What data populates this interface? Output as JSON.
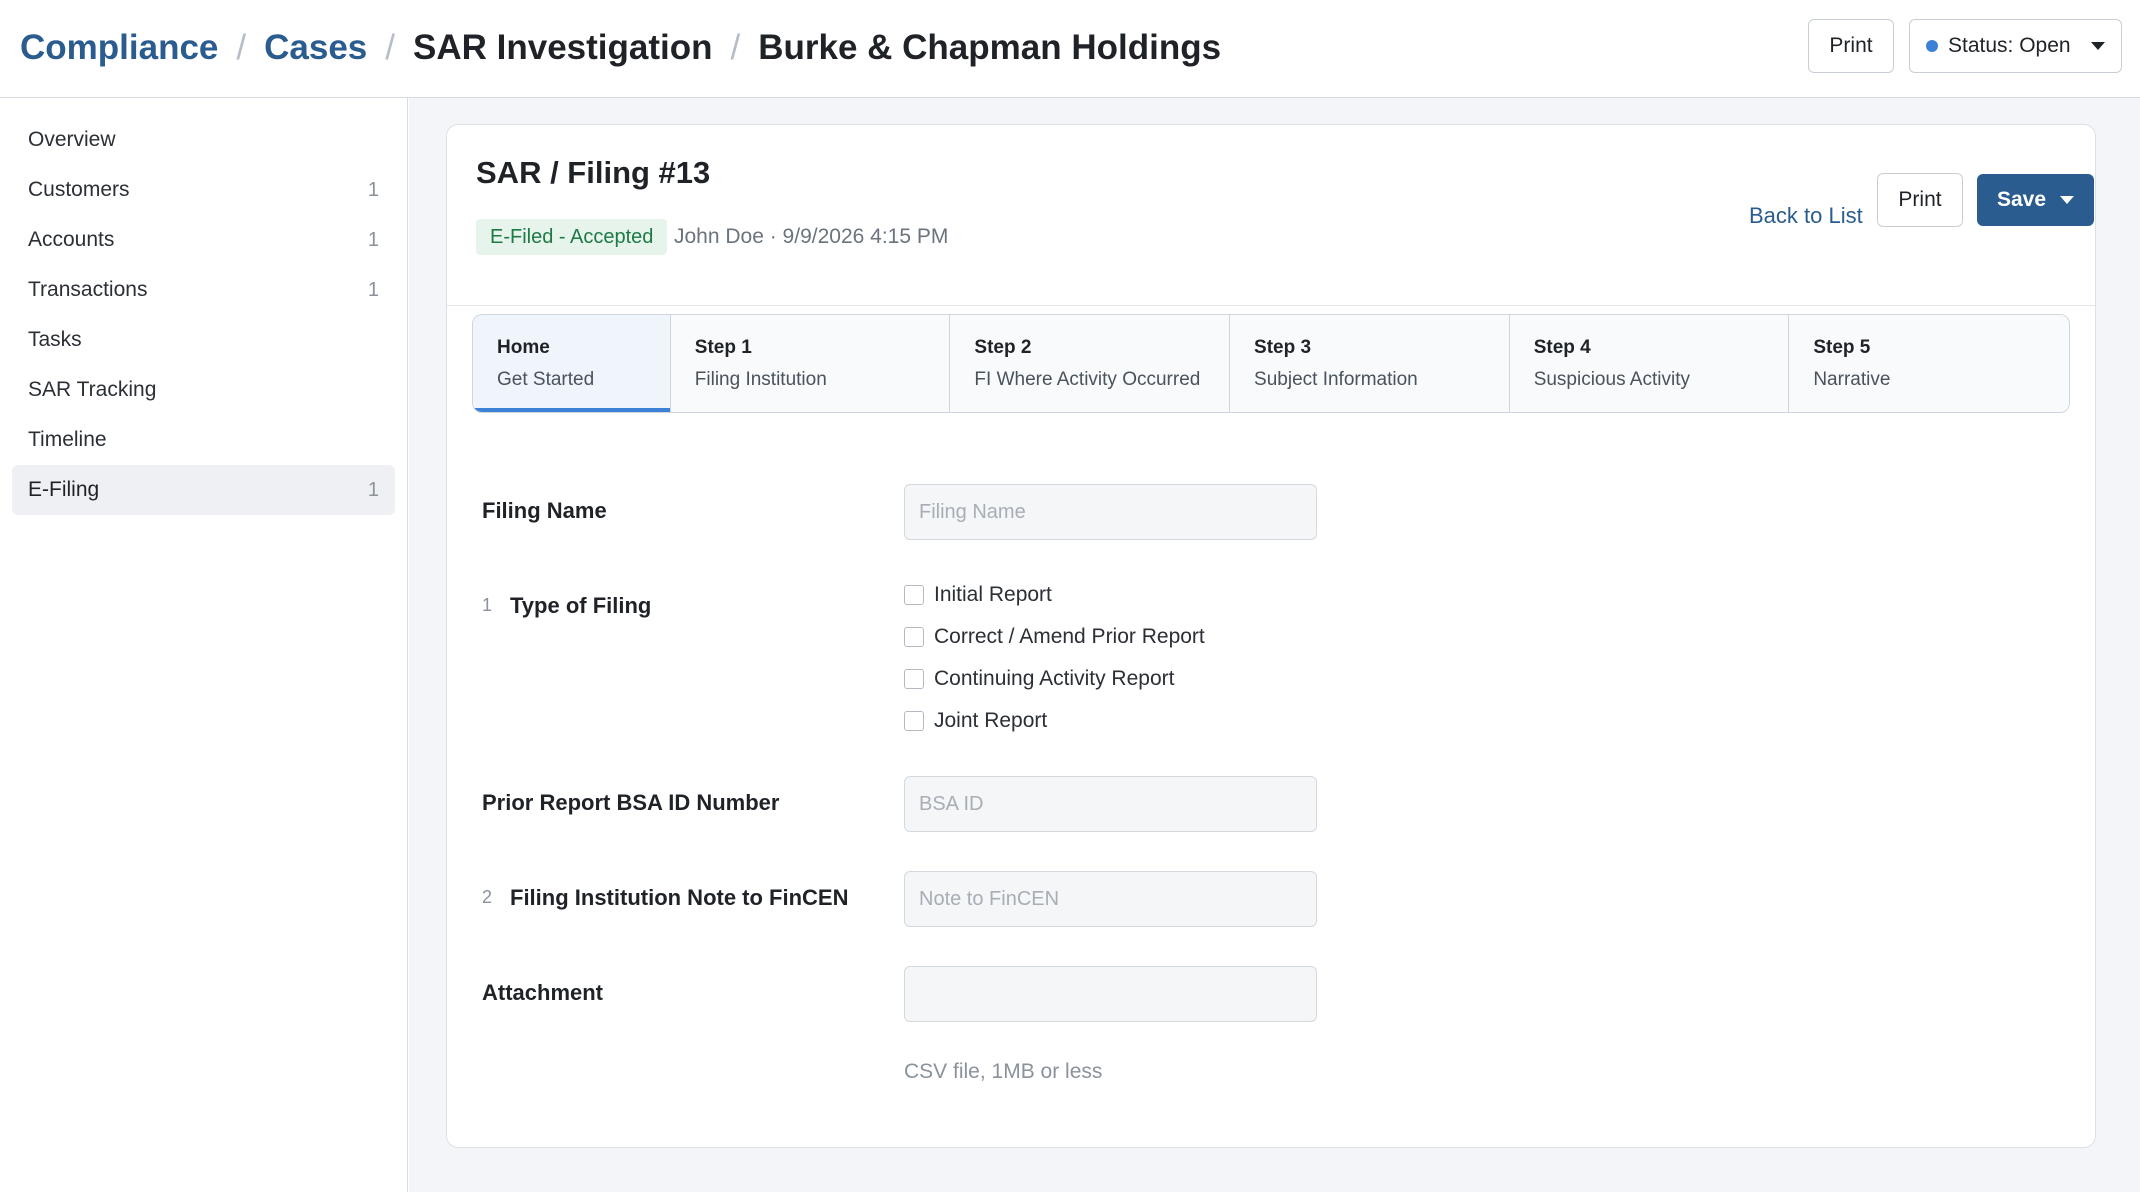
{
  "header": {
    "breadcrumb": {
      "compliance": "Compliance",
      "cases": "Cases",
      "investigation": "SAR Investigation",
      "entity": "Burke & Chapman Holdings",
      "separator": "/"
    },
    "print_label": "Print",
    "status_label": "Status: Open"
  },
  "sidebar": {
    "items": [
      {
        "label": "Overview",
        "count": ""
      },
      {
        "label": "Customers",
        "count": "1"
      },
      {
        "label": "Accounts",
        "count": "1"
      },
      {
        "label": "Transactions",
        "count": "1"
      },
      {
        "label": "Tasks",
        "count": ""
      },
      {
        "label": "SAR Tracking",
        "count": ""
      },
      {
        "label": "Timeline",
        "count": ""
      },
      {
        "label": "E-Filing",
        "count": "1"
      }
    ]
  },
  "filing": {
    "title": "SAR / Filing #13",
    "badge": "E-Filed - Accepted",
    "meta": "John Doe · 9/9/2026 4:15 PM",
    "back_label": "Back to List",
    "print_label": "Print",
    "save_label": "Save"
  },
  "steps": [
    {
      "num": "Home",
      "label": "Get Started"
    },
    {
      "num": "Step 1",
      "label": "Filing Institution"
    },
    {
      "num": "Step 2",
      "label": "FI Where Activity Occurred"
    },
    {
      "num": "Step 3",
      "label": "Subject Information"
    },
    {
      "num": "Step 4",
      "label": "Suspicious Activity"
    },
    {
      "num": "Step 5",
      "label": "Narrative"
    }
  ],
  "form": {
    "filing_name": {
      "label": "Filing Name",
      "placeholder": "Filing Name"
    },
    "type_of_filing": {
      "index": "1",
      "label": "Type of Filing",
      "options": [
        "Initial Report",
        "Correct / Amend Prior Report",
        "Continuing Activity Report",
        "Joint Report"
      ]
    },
    "prior_bsa": {
      "label": "Prior Report BSA ID Number",
      "placeholder": "BSA ID"
    },
    "note": {
      "index": "2",
      "label": "Filing Institution Note to FinCEN",
      "placeholder": "Note to FinCEN"
    },
    "attachment": {
      "label": "Attachment",
      "hint": "CSV file, 1MB or less"
    }
  },
  "colors": {
    "accent": "#2a5c8f",
    "status_dot": "#3b82d6",
    "badge_bg": "#e6f4ec",
    "badge_text": "#1d7a45"
  }
}
